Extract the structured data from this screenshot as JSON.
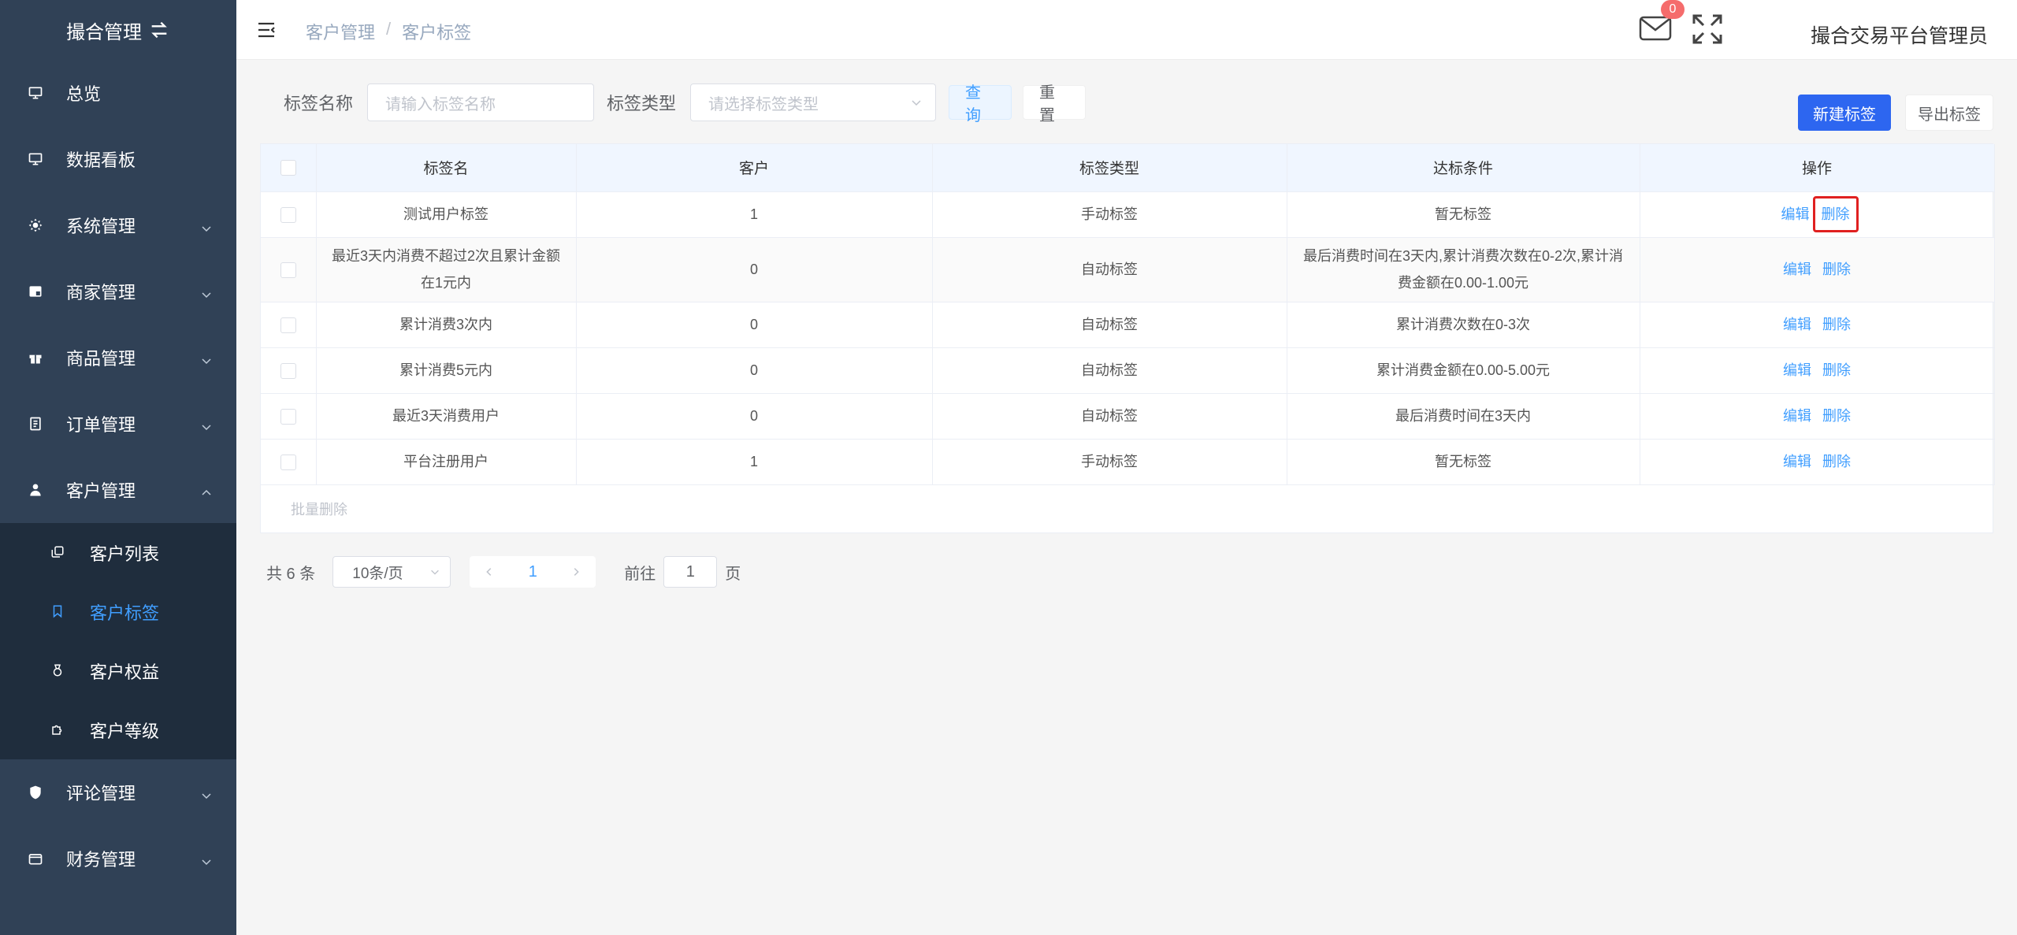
{
  "sidebar": {
    "title": "撮合管理",
    "items": [
      {
        "label": "总览",
        "icon": "monitor-icon",
        "expandable": false
      },
      {
        "label": "数据看板",
        "icon": "monitor-icon",
        "expandable": false
      },
      {
        "label": "系统管理",
        "icon": "gear-icon",
        "expandable": true
      },
      {
        "label": "商家管理",
        "icon": "store-icon",
        "expandable": true
      },
      {
        "label": "商品管理",
        "icon": "gift-icon",
        "expandable": true
      },
      {
        "label": "订单管理",
        "icon": "document-icon",
        "expandable": true
      },
      {
        "label": "客户管理",
        "icon": "user-icon",
        "expandable": true,
        "expanded": true
      }
    ],
    "subitems": [
      {
        "label": "客户列表",
        "icon": "copy-icon"
      },
      {
        "label": "客户标签",
        "icon": "bookmark-icon",
        "active": true
      },
      {
        "label": "客户权益",
        "icon": "medal-icon"
      },
      {
        "label": "客户等级",
        "icon": "puzzle-icon"
      }
    ],
    "items_after": [
      {
        "label": "评论管理",
        "icon": "shield-icon"
      },
      {
        "label": "财务管理",
        "icon": "wallet-icon"
      }
    ]
  },
  "header": {
    "breadcrumb": [
      "客户管理",
      "客户标签"
    ],
    "breadcrumb_sep": "/",
    "notification_count": "0",
    "user_name": "撮合交易平台管理员"
  },
  "search": {
    "name_label": "标签名称",
    "name_placeholder": "请输入标签名称",
    "type_label": "标签类型",
    "type_placeholder": "请选择标签类型",
    "query_button": "查询",
    "reset_button": "重置"
  },
  "actions": {
    "new_button": "新建标签",
    "export_button": "导出标签"
  },
  "table": {
    "columns": [
      "标签名",
      "客户",
      "标签类型",
      "达标条件",
      "操作"
    ],
    "edit_label": "编辑",
    "delete_label": "删除",
    "rows": [
      {
        "name": "测试用户标签",
        "customers": "1",
        "type": "手动标签",
        "condition": "暂无标签"
      },
      {
        "name": "最近3天内消费不超过2次且累计金额在1元内",
        "customers": "0",
        "type": "自动标签",
        "condition": "最后消费时间在3天内,累计消费次数在0-2次,累计消费金额在0.00-1.00元"
      },
      {
        "name": "累计消费3次内",
        "customers": "0",
        "type": "自动标签",
        "condition": "累计消费次数在0-3次"
      },
      {
        "name": "累计消费5元内",
        "customers": "0",
        "type": "自动标签",
        "condition": "累计消费金额在0.00-5.00元"
      },
      {
        "name": "最近3天消费用户",
        "customers": "0",
        "type": "自动标签",
        "condition": "最后消费时间在3天内"
      },
      {
        "name": "平台注册用户",
        "customers": "1",
        "type": "手动标签",
        "condition": "暂无标签"
      }
    ],
    "batch_delete": "批量删除"
  },
  "pagination": {
    "total_text": "共 6 条",
    "page_size": "10条/页",
    "current_page": "1",
    "goto_label": "前往",
    "goto_value": "1",
    "page_suffix": "页"
  },
  "colors": {
    "sidebar_bg": "#304156",
    "submenu_bg": "#1f2d3d",
    "accent": "#409eff",
    "primary_button": "#2d66f0",
    "highlight_border": "#e02020"
  }
}
